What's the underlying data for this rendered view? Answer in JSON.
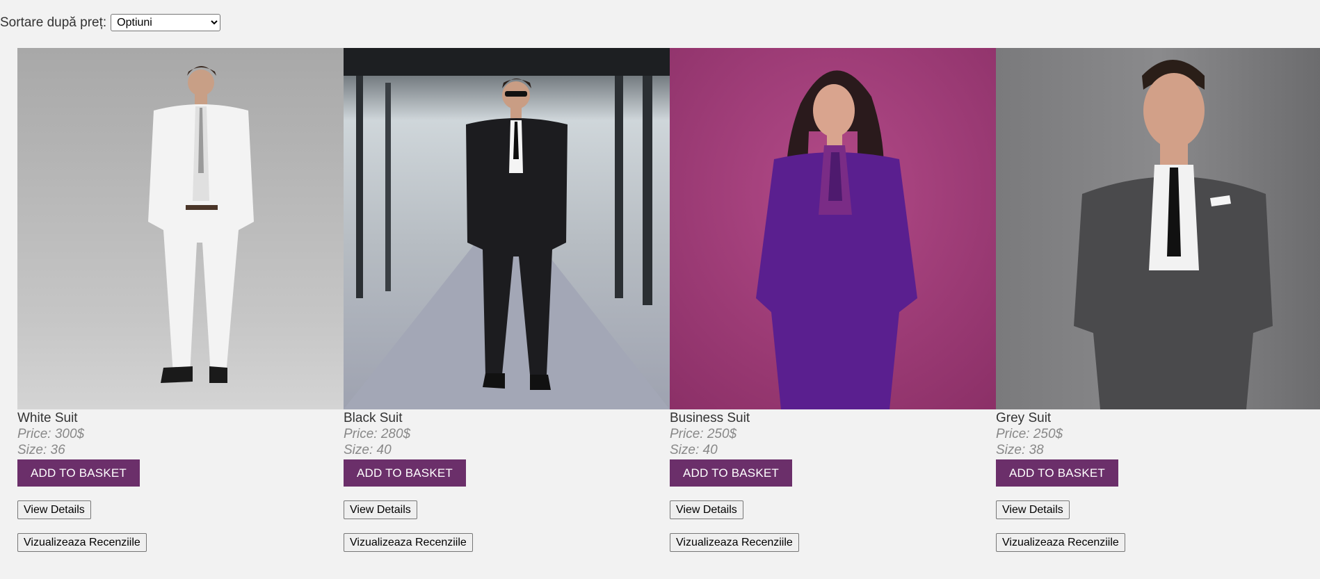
{
  "sort": {
    "label": "Sortare după preț:",
    "selected": "Optiuni"
  },
  "products": [
    {
      "name": "White Suit",
      "price": "Price: 300$",
      "size": "Size: 36",
      "add_label": "ADD TO BASKET",
      "details_label": "View Details",
      "reviews_label": "Vizualizeaza Recenziile",
      "bg": "#a9a9a9",
      "suit_color": "#f4f4f4"
    },
    {
      "name": "Black Suit",
      "price": "Price: 280$",
      "size": "Size: 40",
      "add_label": "ADD TO BASKET",
      "details_label": "View Details",
      "reviews_label": "Vizualizeaza Recenziile",
      "bg": "#6f7a80",
      "suit_color": "#1c1c1f"
    },
    {
      "name": "Business Suit",
      "price": "Price: 250$",
      "size": "Size: 40",
      "add_label": "ADD TO BASKET",
      "details_label": "View Details",
      "reviews_label": "Vizualizeaza Recenziile",
      "bg": "#9e3a78",
      "suit_color": "#5a1f8f"
    },
    {
      "name": "Grey Suit",
      "price": "Price: 250$",
      "size": "Size: 38",
      "add_label": "ADD TO BASKET",
      "details_label": "View Details",
      "reviews_label": "Vizualizeaza Recenziile",
      "bg": "#7a7a7c",
      "suit_color": "#4a4a4c"
    }
  ],
  "colors": {
    "accent": "#6b2f6a",
    "page_bg": "#f2f2f2"
  }
}
